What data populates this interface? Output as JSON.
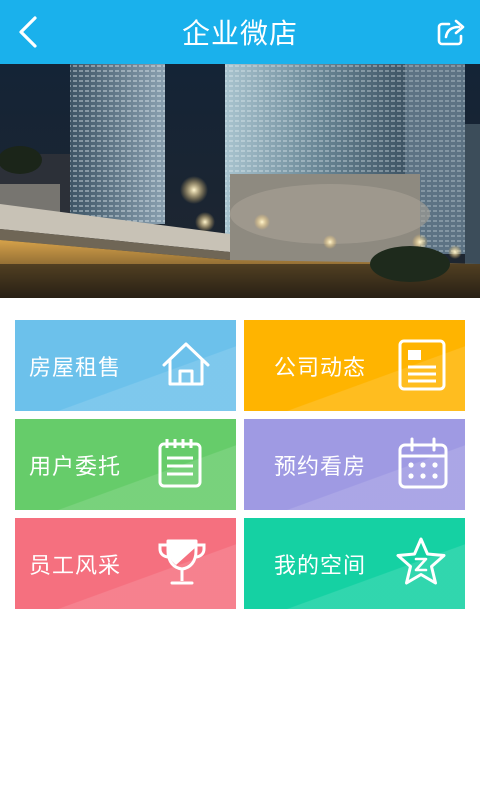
{
  "header": {
    "title": "企业微店",
    "back_icon": "chevron-left-icon",
    "share_icon": "share-icon",
    "bg_color": "#1ab1ec"
  },
  "tiles": [
    {
      "label": "房屋租售",
      "icon": "house-icon",
      "color": "#6cc1eb"
    },
    {
      "label": "公司动态",
      "icon": "document-icon",
      "color": "#ffb400"
    },
    {
      "label": "用户委托",
      "icon": "notepad-icon",
      "color": "#66cc6a"
    },
    {
      "label": "预约看房",
      "icon": "calendar-icon",
      "color": "#9f9ae3"
    },
    {
      "label": "员工风采",
      "icon": "trophy-icon",
      "color": "#f5707f"
    },
    {
      "label": "我的空间",
      "icon": "star-icon",
      "color": "#15d1a3"
    }
  ]
}
